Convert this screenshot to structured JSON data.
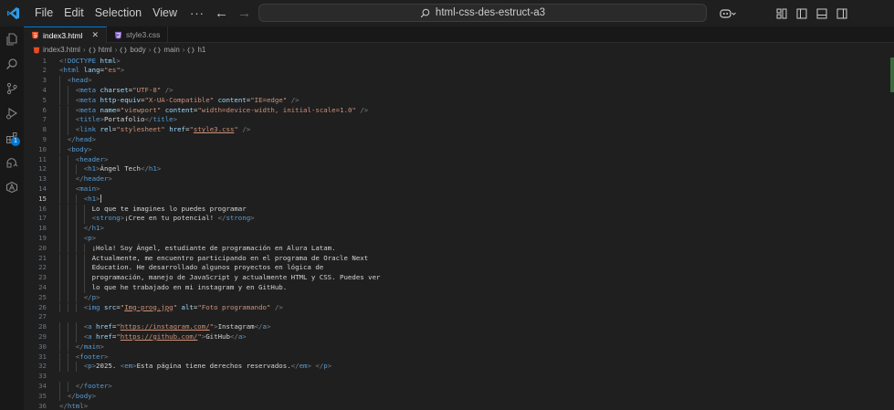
{
  "titlebar": {
    "menu": [
      "File",
      "Edit",
      "Selection",
      "View"
    ],
    "more": "···",
    "search_text": "html-css-des-estruct-a3"
  },
  "tabs": [
    {
      "label": "index3.html",
      "icon": "html-file-icon",
      "active": true
    },
    {
      "label": "style3.css",
      "icon": "css-file-icon",
      "active": false
    }
  ],
  "breadcrumb": [
    "index3.html",
    "html",
    "body",
    "main",
    "h1"
  ],
  "activity": {
    "badge": "1"
  },
  "editor": {
    "current_line": 15,
    "lines": [
      {
        "n": 1,
        "indent": 0,
        "t": [
          [
            "tag",
            "<!"
          ],
          [
            "name",
            "DOCTYPE"
          ],
          [
            "text",
            " "
          ],
          [
            "attr",
            "html"
          ],
          [
            "tag",
            ">"
          ]
        ]
      },
      {
        "n": 2,
        "indent": 0,
        "t": [
          [
            "tag",
            "<"
          ],
          [
            "name",
            "html"
          ],
          [
            "text",
            " "
          ],
          [
            "attr",
            "lang"
          ],
          [
            "text",
            "="
          ],
          [
            "val",
            "\"es\""
          ],
          [
            "tag",
            ">"
          ]
        ]
      },
      {
        "n": 3,
        "indent": 1,
        "t": [
          [
            "tag",
            "<"
          ],
          [
            "name",
            "head"
          ],
          [
            "tag",
            ">"
          ]
        ]
      },
      {
        "n": 4,
        "indent": 2,
        "t": [
          [
            "tag",
            "<"
          ],
          [
            "name",
            "meta"
          ],
          [
            "text",
            " "
          ],
          [
            "attr",
            "charset"
          ],
          [
            "text",
            "="
          ],
          [
            "val",
            "\"UTF-8\""
          ],
          [
            "text",
            " "
          ],
          [
            "tag",
            "/>"
          ]
        ]
      },
      {
        "n": 5,
        "indent": 2,
        "t": [
          [
            "tag",
            "<"
          ],
          [
            "name",
            "meta"
          ],
          [
            "text",
            " "
          ],
          [
            "attr",
            "http-equiv"
          ],
          [
            "text",
            "="
          ],
          [
            "val",
            "\"X-UA-Compatible\""
          ],
          [
            "text",
            " "
          ],
          [
            "attr",
            "content"
          ],
          [
            "text",
            "="
          ],
          [
            "val",
            "\"IE=edge\""
          ],
          [
            "text",
            " "
          ],
          [
            "tag",
            "/>"
          ]
        ]
      },
      {
        "n": 6,
        "indent": 2,
        "t": [
          [
            "tag",
            "<"
          ],
          [
            "name",
            "meta"
          ],
          [
            "text",
            " "
          ],
          [
            "attr",
            "name"
          ],
          [
            "text",
            "="
          ],
          [
            "val",
            "\"viewport\""
          ],
          [
            "text",
            " "
          ],
          [
            "attr",
            "content"
          ],
          [
            "text",
            "="
          ],
          [
            "val",
            "\"width=device-width, initial-scale=1.0\""
          ],
          [
            "text",
            " "
          ],
          [
            "tag",
            "/>"
          ]
        ]
      },
      {
        "n": 7,
        "indent": 2,
        "t": [
          [
            "tag",
            "<"
          ],
          [
            "name",
            "title"
          ],
          [
            "tag",
            ">"
          ],
          [
            "text",
            "Portafolio"
          ],
          [
            "tag",
            "</"
          ],
          [
            "name",
            "title"
          ],
          [
            "tag",
            ">"
          ]
        ]
      },
      {
        "n": 8,
        "indent": 2,
        "t": [
          [
            "tag",
            "<"
          ],
          [
            "name",
            "link"
          ],
          [
            "text",
            " "
          ],
          [
            "attr",
            "rel"
          ],
          [
            "text",
            "="
          ],
          [
            "val",
            "\"stylesheet\""
          ],
          [
            "text",
            " "
          ],
          [
            "attr",
            "href"
          ],
          [
            "text",
            "="
          ],
          [
            "val",
            "\""
          ],
          [
            "link",
            "style3.css"
          ],
          [
            "val",
            "\""
          ],
          [
            "text",
            " "
          ],
          [
            "tag",
            "/>"
          ]
        ]
      },
      {
        "n": 9,
        "indent": 1,
        "t": [
          [
            "tag",
            "</"
          ],
          [
            "name",
            "head"
          ],
          [
            "tag",
            ">"
          ]
        ]
      },
      {
        "n": 10,
        "indent": 1,
        "t": [
          [
            "tag",
            "<"
          ],
          [
            "name",
            "body"
          ],
          [
            "tag",
            ">"
          ]
        ]
      },
      {
        "n": 11,
        "indent": 2,
        "t": [
          [
            "tag",
            "<"
          ],
          [
            "name",
            "header"
          ],
          [
            "tag",
            ">"
          ]
        ]
      },
      {
        "n": 12,
        "indent": 3,
        "t": [
          [
            "tag",
            "<"
          ],
          [
            "name",
            "h1"
          ],
          [
            "tag",
            ">"
          ],
          [
            "text",
            "Ángel Tech"
          ],
          [
            "tag",
            "</"
          ],
          [
            "name",
            "h1"
          ],
          [
            "tag",
            ">"
          ]
        ]
      },
      {
        "n": 13,
        "indent": 2,
        "t": [
          [
            "tag",
            "</"
          ],
          [
            "name",
            "header"
          ],
          [
            "tag",
            ">"
          ]
        ]
      },
      {
        "n": 14,
        "indent": 2,
        "t": [
          [
            "tag",
            "<"
          ],
          [
            "name",
            "main"
          ],
          [
            "tag",
            ">"
          ]
        ]
      },
      {
        "n": 15,
        "indent": 3,
        "t": [
          [
            "tag",
            "<"
          ],
          [
            "name",
            "h1"
          ],
          [
            "tag",
            ">"
          ]
        ],
        "cursor": true
      },
      {
        "n": 16,
        "indent": 4,
        "t": [
          [
            "text",
            "Lo que te imagines lo puedes programar"
          ]
        ]
      },
      {
        "n": 17,
        "indent": 4,
        "t": [
          [
            "tag",
            "<"
          ],
          [
            "name",
            "strong"
          ],
          [
            "tag",
            ">"
          ],
          [
            "text",
            "¡Cree en tu potencial! "
          ],
          [
            "tag",
            "</"
          ],
          [
            "name",
            "strong"
          ],
          [
            "tag",
            ">"
          ]
        ]
      },
      {
        "n": 18,
        "indent": 3,
        "t": [
          [
            "tag",
            "</"
          ],
          [
            "name",
            "h1"
          ],
          [
            "tag",
            ">"
          ]
        ]
      },
      {
        "n": 19,
        "indent": 3,
        "t": [
          [
            "tag",
            "<"
          ],
          [
            "name",
            "p"
          ],
          [
            "tag",
            ">"
          ]
        ]
      },
      {
        "n": 20,
        "indent": 4,
        "t": [
          [
            "text",
            "¡Hola! Soy Ángel, estudiante de programación en Alura Latam."
          ]
        ]
      },
      {
        "n": 21,
        "indent": 4,
        "t": [
          [
            "text",
            "Actualmente, me encuentro participando en el programa de Oracle Next"
          ]
        ]
      },
      {
        "n": 22,
        "indent": 4,
        "t": [
          [
            "text",
            "Education. He desarrollado algunos proyectos en lógica de"
          ]
        ]
      },
      {
        "n": 23,
        "indent": 4,
        "t": [
          [
            "text",
            "programación, manejo de JavaScript y actualmente HTML y CSS. Puedes ver"
          ]
        ]
      },
      {
        "n": 24,
        "indent": 4,
        "t": [
          [
            "text",
            "lo que he trabajado en mi instagram y en GitHub."
          ]
        ]
      },
      {
        "n": 25,
        "indent": 3,
        "t": [
          [
            "tag",
            "</"
          ],
          [
            "name",
            "p"
          ],
          [
            "tag",
            ">"
          ]
        ]
      },
      {
        "n": 26,
        "indent": 3,
        "t": [
          [
            "tag",
            "<"
          ],
          [
            "name",
            "img"
          ],
          [
            "text",
            " "
          ],
          [
            "attr",
            "src"
          ],
          [
            "text",
            "="
          ],
          [
            "val",
            "\""
          ],
          [
            "link",
            "Img-prog.jpg"
          ],
          [
            "val",
            "\""
          ],
          [
            "text",
            " "
          ],
          [
            "attr",
            "alt"
          ],
          [
            "text",
            "="
          ],
          [
            "val",
            "\"Foto programando\""
          ],
          [
            "text",
            " "
          ],
          [
            "tag",
            "/>"
          ]
        ]
      },
      {
        "n": 27,
        "indent": 0,
        "t": []
      },
      {
        "n": 28,
        "indent": 3,
        "t": [
          [
            "tag",
            "<"
          ],
          [
            "name",
            "a"
          ],
          [
            "text",
            " "
          ],
          [
            "attr",
            "href"
          ],
          [
            "text",
            "="
          ],
          [
            "val",
            "\""
          ],
          [
            "link",
            "https://instagram.com/"
          ],
          [
            "val",
            "\""
          ],
          [
            "tag",
            ">"
          ],
          [
            "text",
            "Instagram"
          ],
          [
            "tag",
            "</"
          ],
          [
            "name",
            "a"
          ],
          [
            "tag",
            ">"
          ]
        ]
      },
      {
        "n": 29,
        "indent": 3,
        "t": [
          [
            "tag",
            "<"
          ],
          [
            "name",
            "a"
          ],
          [
            "text",
            " "
          ],
          [
            "attr",
            "href"
          ],
          [
            "text",
            "="
          ],
          [
            "val",
            "\""
          ],
          [
            "link",
            "https://github.com/"
          ],
          [
            "val",
            "\""
          ],
          [
            "tag",
            ">"
          ],
          [
            "text",
            "GitHub"
          ],
          [
            "tag",
            "</"
          ],
          [
            "name",
            "a"
          ],
          [
            "tag",
            ">"
          ]
        ]
      },
      {
        "n": 30,
        "indent": 2,
        "t": [
          [
            "tag",
            "</"
          ],
          [
            "name",
            "main"
          ],
          [
            "tag",
            ">"
          ]
        ]
      },
      {
        "n": 31,
        "indent": 2,
        "t": [
          [
            "tag",
            "<"
          ],
          [
            "name",
            "footer"
          ],
          [
            "tag",
            ">"
          ]
        ]
      },
      {
        "n": 32,
        "indent": 3,
        "t": [
          [
            "tag",
            "<"
          ],
          [
            "name",
            "p"
          ],
          [
            "tag",
            ">"
          ],
          [
            "text",
            "2025. "
          ],
          [
            "tag",
            "<"
          ],
          [
            "name",
            "em"
          ],
          [
            "tag",
            ">"
          ],
          [
            "text",
            "Esta página tiene derechos reservados."
          ],
          [
            "tag",
            "</"
          ],
          [
            "name",
            "em"
          ],
          [
            "tag",
            ">"
          ],
          [
            "text",
            " "
          ],
          [
            "tag",
            "</"
          ],
          [
            "name",
            "p"
          ],
          [
            "tag",
            ">"
          ]
        ]
      },
      {
        "n": 33,
        "indent": 0,
        "t": []
      },
      {
        "n": 34,
        "indent": 2,
        "t": [
          [
            "tag",
            "</"
          ],
          [
            "name",
            "footer"
          ],
          [
            "tag",
            ">"
          ]
        ]
      },
      {
        "n": 35,
        "indent": 1,
        "t": [
          [
            "tag",
            "</"
          ],
          [
            "name",
            "body"
          ],
          [
            "tag",
            ">"
          ]
        ]
      },
      {
        "n": 36,
        "indent": 0,
        "t": [
          [
            "tag",
            "</"
          ],
          [
            "name",
            "html"
          ],
          [
            "tag",
            ">"
          ]
        ]
      }
    ]
  }
}
